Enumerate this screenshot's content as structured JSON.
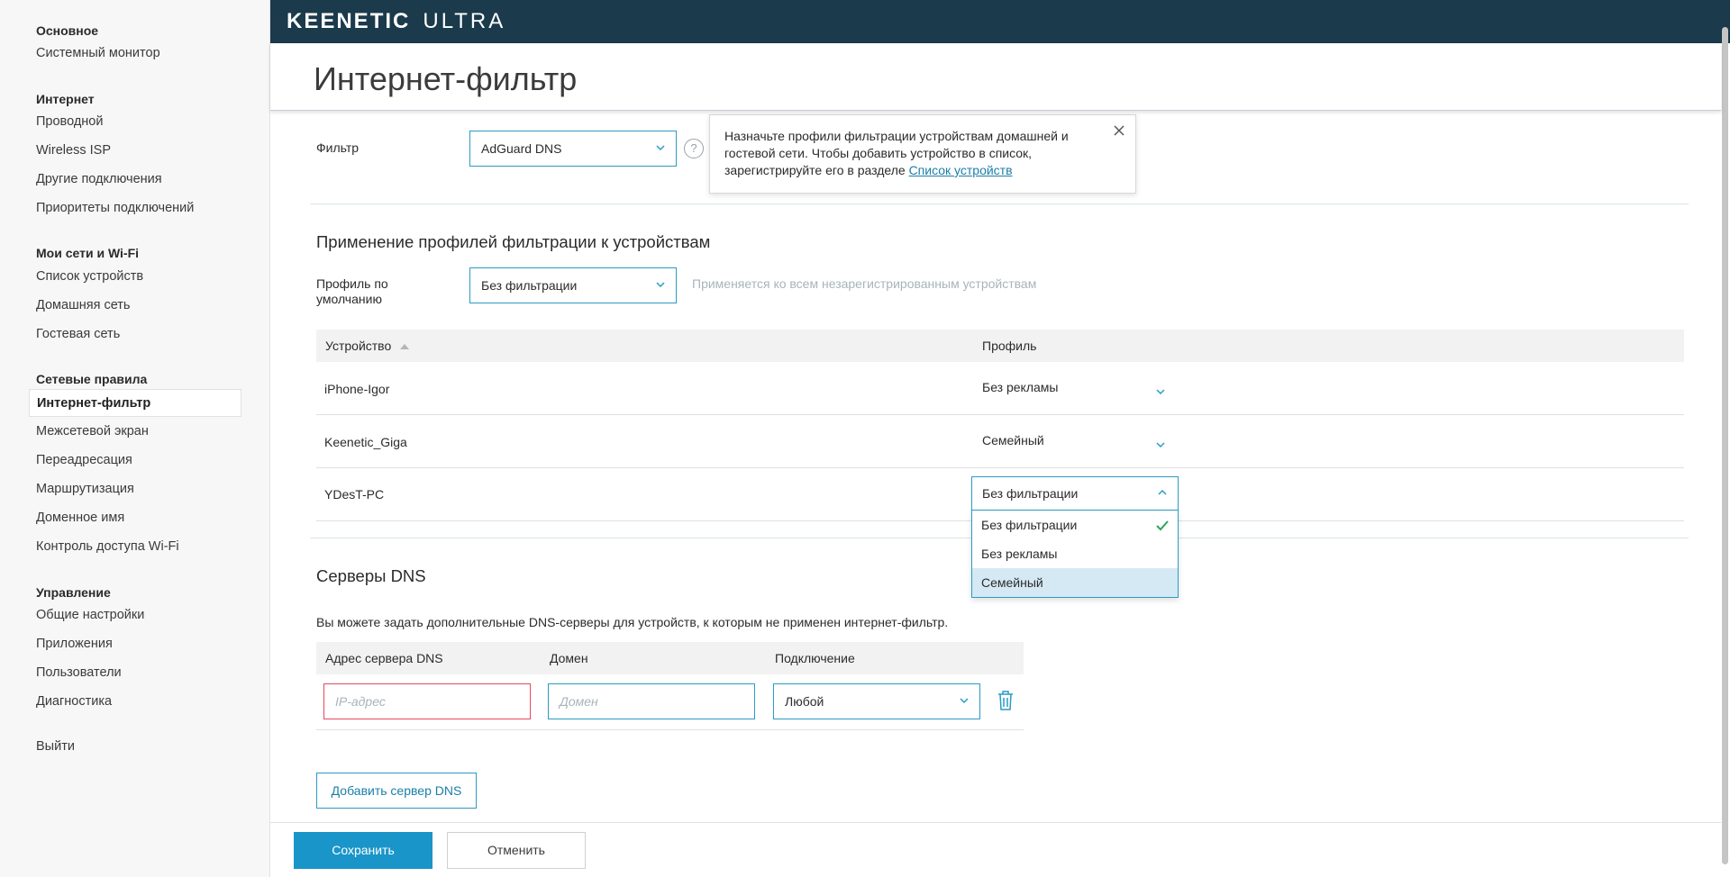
{
  "header": {
    "brand": "KEENETIC",
    "model": "ULTRA",
    "page_title": "Интернет-фильтр"
  },
  "sidebar": {
    "sections": [
      {
        "title": "Основное",
        "items": [
          "Системный монитор"
        ]
      },
      {
        "title": "Интернет",
        "items": [
          "Проводной",
          "Wireless ISP",
          "Другие подключения",
          "Приоритеты подключений"
        ]
      },
      {
        "title": "Мои сети и Wi-Fi",
        "items": [
          "Список устройств",
          "Домашняя сеть",
          "Гостевая сеть"
        ]
      },
      {
        "title": "Сетевые правила",
        "items": [
          "Интернет-фильтр",
          "Межсетевой экран",
          "Переадресация",
          "Маршрутизация",
          "Доменное имя",
          "Контроль доступа Wi-Fi"
        ]
      },
      {
        "title": "Управление",
        "items": [
          "Общие настройки",
          "Приложения",
          "Пользователи",
          "Диагностика"
        ]
      }
    ],
    "active_item": "Интернет-фильтр",
    "logout": "Выйти"
  },
  "filter": {
    "label": "Фильтр",
    "value": "AdGuard DNS",
    "help": "?",
    "tooltip_text": "Назначьте профили фильтрации устройствам домашней и гостевой сети. Чтобы добавить устройство в список, зарегистрируйте его в разделе",
    "tooltip_link": "Список устройств"
  },
  "profiles": {
    "title": "Применение профилей фильтрации к устройствам",
    "default_label": "Профиль по умолчанию",
    "default_value": "Без фильтрации",
    "default_hint": "Применяется ко всем незарегистрированным устройствам",
    "columns": [
      "Устройство",
      "Профиль"
    ],
    "rows": [
      {
        "device": "iPhone-Igor",
        "profile": "Без рекламы"
      },
      {
        "device": "Keenetic_Giga",
        "profile": "Семейный"
      },
      {
        "device": "YDesT-PC",
        "profile": "Без фильтрации"
      }
    ],
    "dropdown_options": [
      "Без фильтрации",
      "Без рекламы",
      "Семейный"
    ],
    "dropdown_selected": "Без фильтрации",
    "dropdown_highlighted": "Семейный"
  },
  "dns": {
    "title": "Серверы DNS",
    "description": "Вы можете задать дополнительные DNS-серверы для устройств, к которым не применен интернет-фильтр.",
    "columns": [
      "Адрес сервера DNS",
      "Домен",
      "Подключение"
    ],
    "ip_placeholder": "IP-адрес",
    "domain_placeholder": "Домен",
    "connection_value": "Любой",
    "add_button": "Добавить сервер DNS"
  },
  "footer": {
    "save": "Сохранить",
    "cancel": "Отменить"
  },
  "colors": {
    "header_bg": "#1b3a4b",
    "accent": "#1a95c9",
    "error": "#e34a5d",
    "highlight": "#d4e9f3"
  }
}
